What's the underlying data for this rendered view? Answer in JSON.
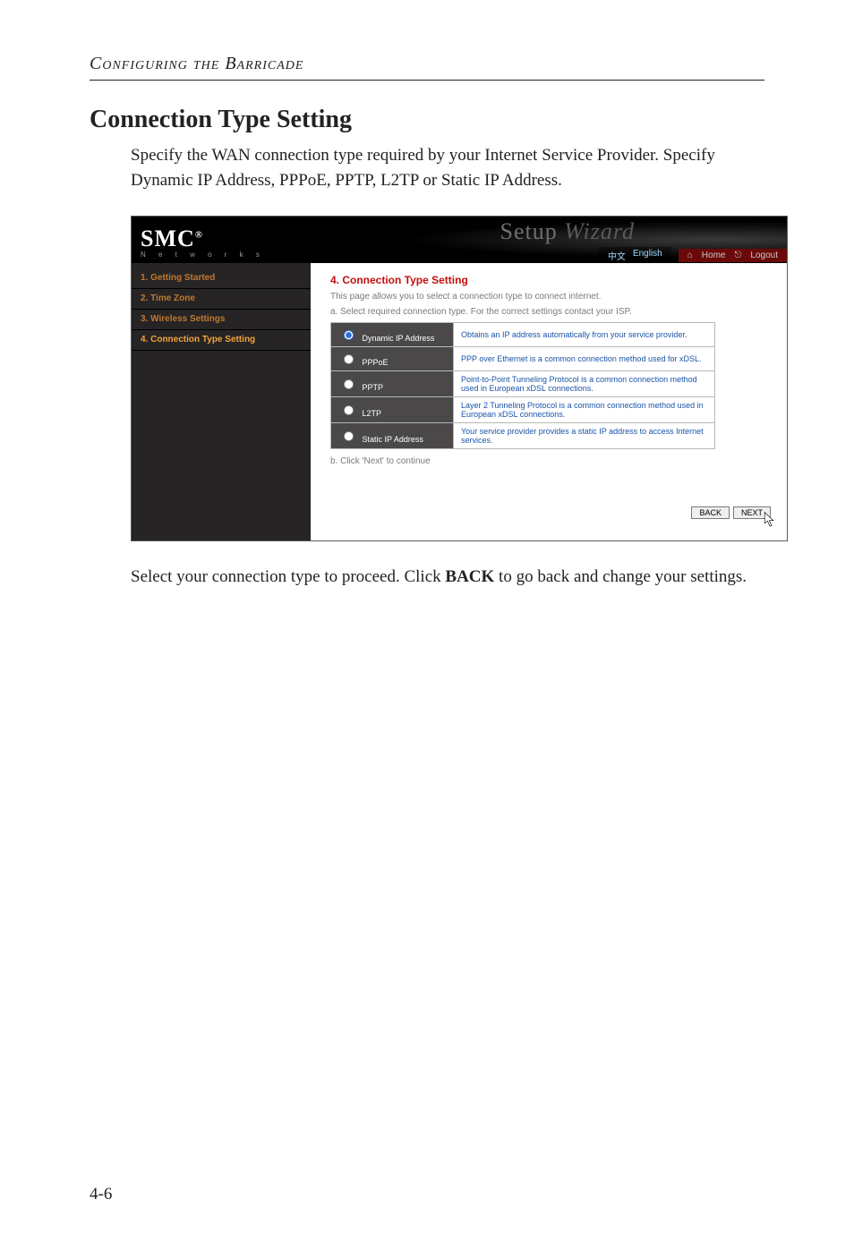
{
  "running_head": "Configuring the Barricade",
  "section_title": "Connection Type Setting",
  "intro_paragraph": "Specify the WAN connection type required by your Internet Service Provider. Specify Dynamic IP Address, PPPoE, PPTP, L2TP or Static IP Address.",
  "screenshot": {
    "brand": "SMC",
    "brand_reg": "®",
    "brand_sub": "N e t w o r k s",
    "banner_word_a": "Setup",
    "banner_word_b": "Wizard",
    "lang_cn": "中文",
    "lang_en": "English",
    "home_label": "Home",
    "logout_label": "Logout",
    "nav": [
      "1. Getting Started",
      "2. Time Zone",
      "3. Wireless Settings",
      "4. Connection Type Setting"
    ],
    "panel_heading": "4. Connection Type Setting",
    "panel_intro": "This page allows you to select a connection type to connect internet.",
    "panel_step_a": "a. Select required connection type. For the correct settings contact your ISP.",
    "options": [
      {
        "label": "Dynamic IP Address",
        "desc": "Obtains an IP address automatically from your service provider."
      },
      {
        "label": "PPPoE",
        "desc": "PPP over Ethernet is a common connection method used for xDSL."
      },
      {
        "label": "PPTP",
        "desc": "Point-to-Point Tunneling Protocol is a common connection method used in European xDSL connections."
      },
      {
        "label": "L2TP",
        "desc": "Layer 2 Tunneling Protocol is a common connection method used in European xDSL connections."
      },
      {
        "label": "Static IP Address",
        "desc": "Your service provider provides a static IP address to access Internet services."
      }
    ],
    "panel_step_b": "b. Click 'Next' to continue",
    "btn_back": "BACK",
    "btn_next": "NEXT"
  },
  "closing_before_back": "Select your connection type to proceed. Click ",
  "closing_back": "BACK",
  "closing_after_back": " to go back and change your settings.",
  "page_number": "4-6"
}
